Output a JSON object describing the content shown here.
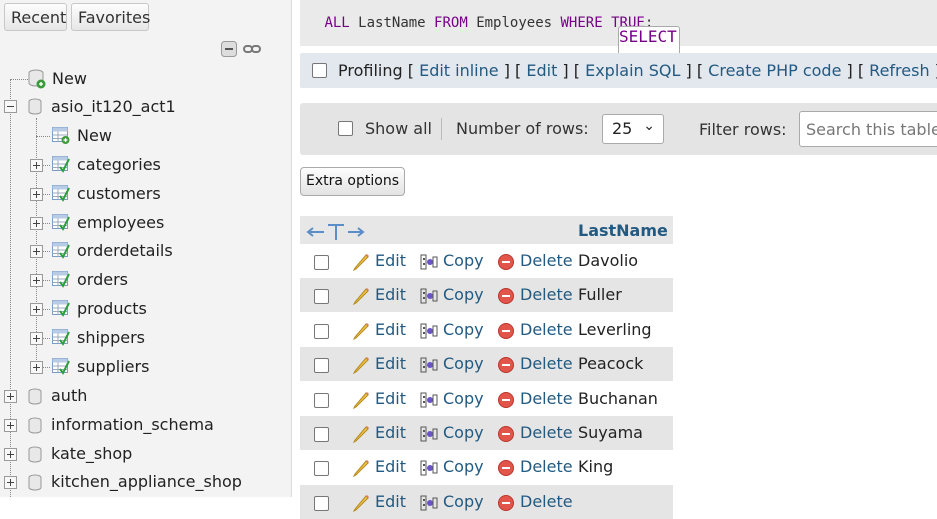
{
  "sidebar": {
    "recent_label": "Recent",
    "favorites_label": "Favorites",
    "new_label": "New",
    "database": "asio_it120_act1",
    "db_new_label": "New",
    "tables": [
      "categories",
      "customers",
      "employees",
      "orderdetails",
      "orders",
      "products",
      "shippers",
      "suppliers"
    ],
    "other_databases": [
      "auth",
      "information_schema",
      "kate_shop",
      "kitchen_appliance_shop"
    ]
  },
  "sql": {
    "select": "SELECT",
    "all": "ALL",
    "column": "LastName",
    "from": "FROM",
    "table": "Employees",
    "where": "WHERE",
    "true": "TRUE",
    "end": ";"
  },
  "profiling": {
    "label": "Profiling",
    "links": [
      "Edit inline",
      "Edit",
      "Explain SQL",
      "Create PHP code",
      "Refresh"
    ]
  },
  "nav": {
    "show_all": "Show all",
    "rows_label": "Number of rows:",
    "rows_value": "25",
    "filter_label": "Filter rows:",
    "search_placeholder": "Search this table"
  },
  "extra_options": "Extra options",
  "table": {
    "column": "LastName",
    "actions": {
      "edit": "Edit",
      "copy": "Copy",
      "delete": "Delete"
    },
    "rows": [
      "Davolio",
      "Fuller",
      "Leverling",
      "Peacock",
      "Buchanan",
      "Suyama",
      "King"
    ]
  }
}
